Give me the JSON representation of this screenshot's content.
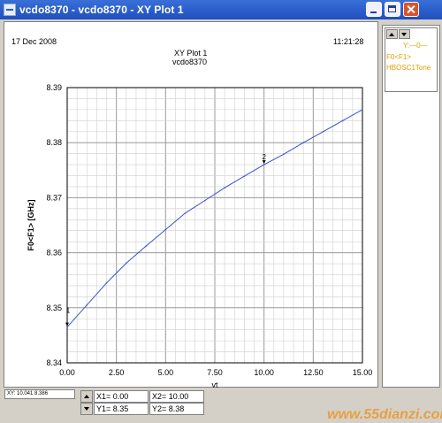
{
  "window": {
    "title": "vcdo8370 - vcdo8370 - XY Plot 1"
  },
  "plot": {
    "date": "17 Dec 2008",
    "time": "11:21:28",
    "title": "XY Plot 1",
    "subtitle": "vcdo8370"
  },
  "chart_data": {
    "type": "line",
    "xlabel": "vt",
    "ylabel": "F0<F1> [GHz]",
    "xlim": [
      0,
      15
    ],
    "ylim": [
      8.34,
      8.39
    ],
    "x_ticks": [
      "0.00",
      "2.50",
      "5.00",
      "7.50",
      "10.00",
      "12.50",
      "15.00"
    ],
    "y_ticks": [
      "8.34",
      "8.35",
      "8.36",
      "8.37",
      "8.38",
      "8.39"
    ],
    "grid": true,
    "line_color": "#3b4fd0",
    "series": [
      {
        "x": [
          0,
          1,
          2,
          3,
          4,
          5,
          6,
          7,
          8,
          9,
          10,
          11,
          12,
          13,
          14,
          15
        ],
        "values": [
          8.3465,
          8.3505,
          8.3545,
          8.3581,
          8.3612,
          8.3642,
          8.3672,
          8.3695,
          8.3718,
          8.3739,
          8.376,
          8.3779,
          8.38,
          8.382,
          8.384,
          8.386
        ]
      }
    ],
    "markers": [
      {
        "label": "1",
        "x": 0,
        "y": 8.3465
      },
      {
        "label": "2",
        "x": 10,
        "y": 8.376
      }
    ]
  },
  "legend": {
    "axis_label": "Y:—0—",
    "trace_name": "F0<F1>",
    "trace_source": "HBOSC1Tone"
  },
  "readout": {
    "xy": "XY: 10.041 8.386",
    "x1": "X1= 0.00",
    "y1": "Y1= 8.35",
    "x2": "X2= 10.00",
    "y2": "Y2= 8.38"
  },
  "watermark": "www.55dianzi.com"
}
